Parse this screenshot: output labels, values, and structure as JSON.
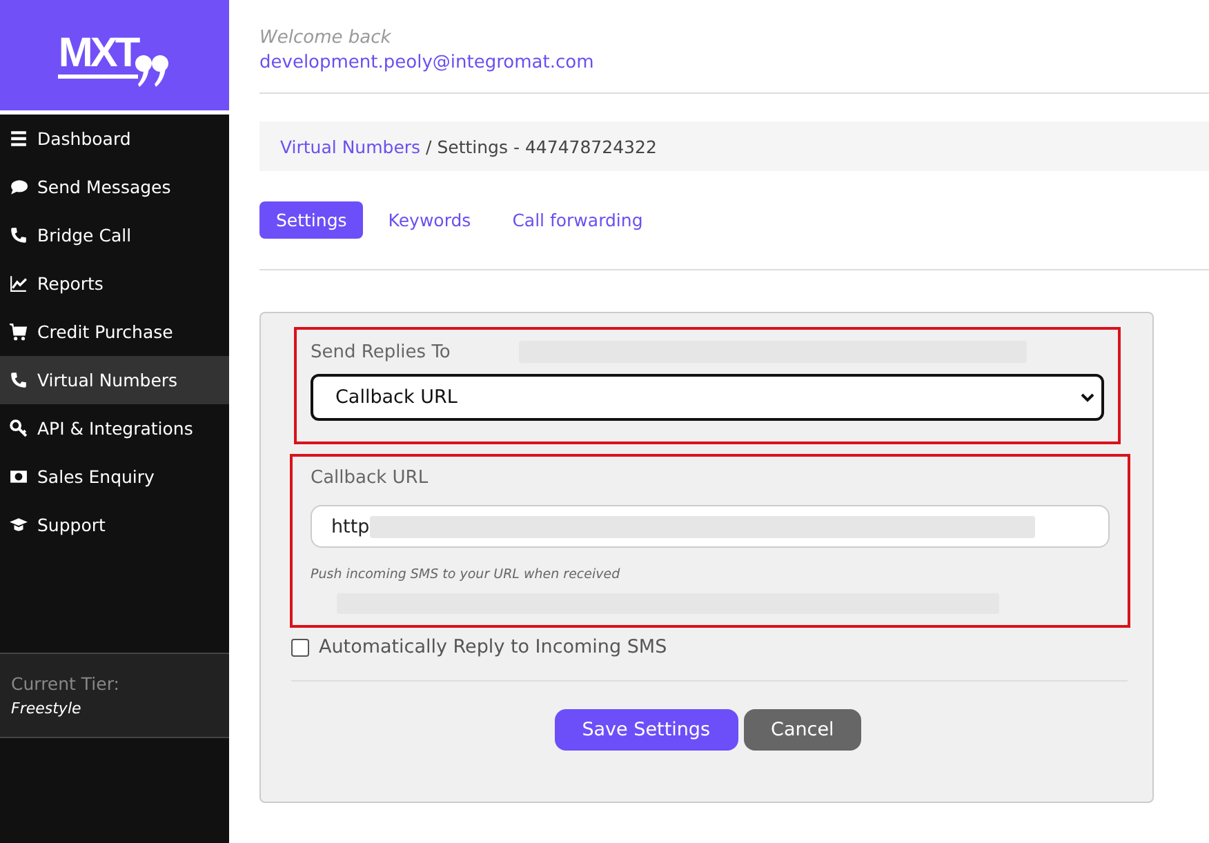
{
  "logo": {
    "text": "MXT"
  },
  "sidebar": {
    "items": [
      {
        "label": "Dashboard",
        "selected": false
      },
      {
        "label": "Send Messages",
        "selected": false
      },
      {
        "label": "Bridge Call",
        "selected": false
      },
      {
        "label": "Reports",
        "selected": false
      },
      {
        "label": "Credit Purchase",
        "selected": false
      },
      {
        "label": "Virtual Numbers",
        "selected": true
      },
      {
        "label": "API & Integrations",
        "selected": false
      },
      {
        "label": "Sales Enquiry",
        "selected": false
      },
      {
        "label": "Support",
        "selected": false
      }
    ],
    "tier": {
      "label": "Current Tier:",
      "value": "Freestyle"
    }
  },
  "header": {
    "greeting": "Welcome back",
    "email": "development.peoly@integromat.com"
  },
  "breadcrumb": {
    "link": "Virtual Numbers",
    "rest": "/ Settings - 447478724322"
  },
  "tabs": [
    {
      "label": "Settings",
      "selected": true
    },
    {
      "label": "Keywords",
      "selected": false
    },
    {
      "label": "Call forwarding",
      "selected": false
    }
  ],
  "form": {
    "send_replies_label": "Send Replies To",
    "send_replies_value": "Callback URL",
    "callback_label": "Callback URL",
    "callback_value": "http",
    "callback_help": "Push incoming SMS to your URL when received",
    "auto_reply": {
      "label": "Automatically Reply to Incoming SMS",
      "checked": false
    },
    "buttons": [
      {
        "label": "Save Settings",
        "kind": "primary"
      },
      {
        "label": "Cancel",
        "kind": "secondary"
      }
    ]
  }
}
